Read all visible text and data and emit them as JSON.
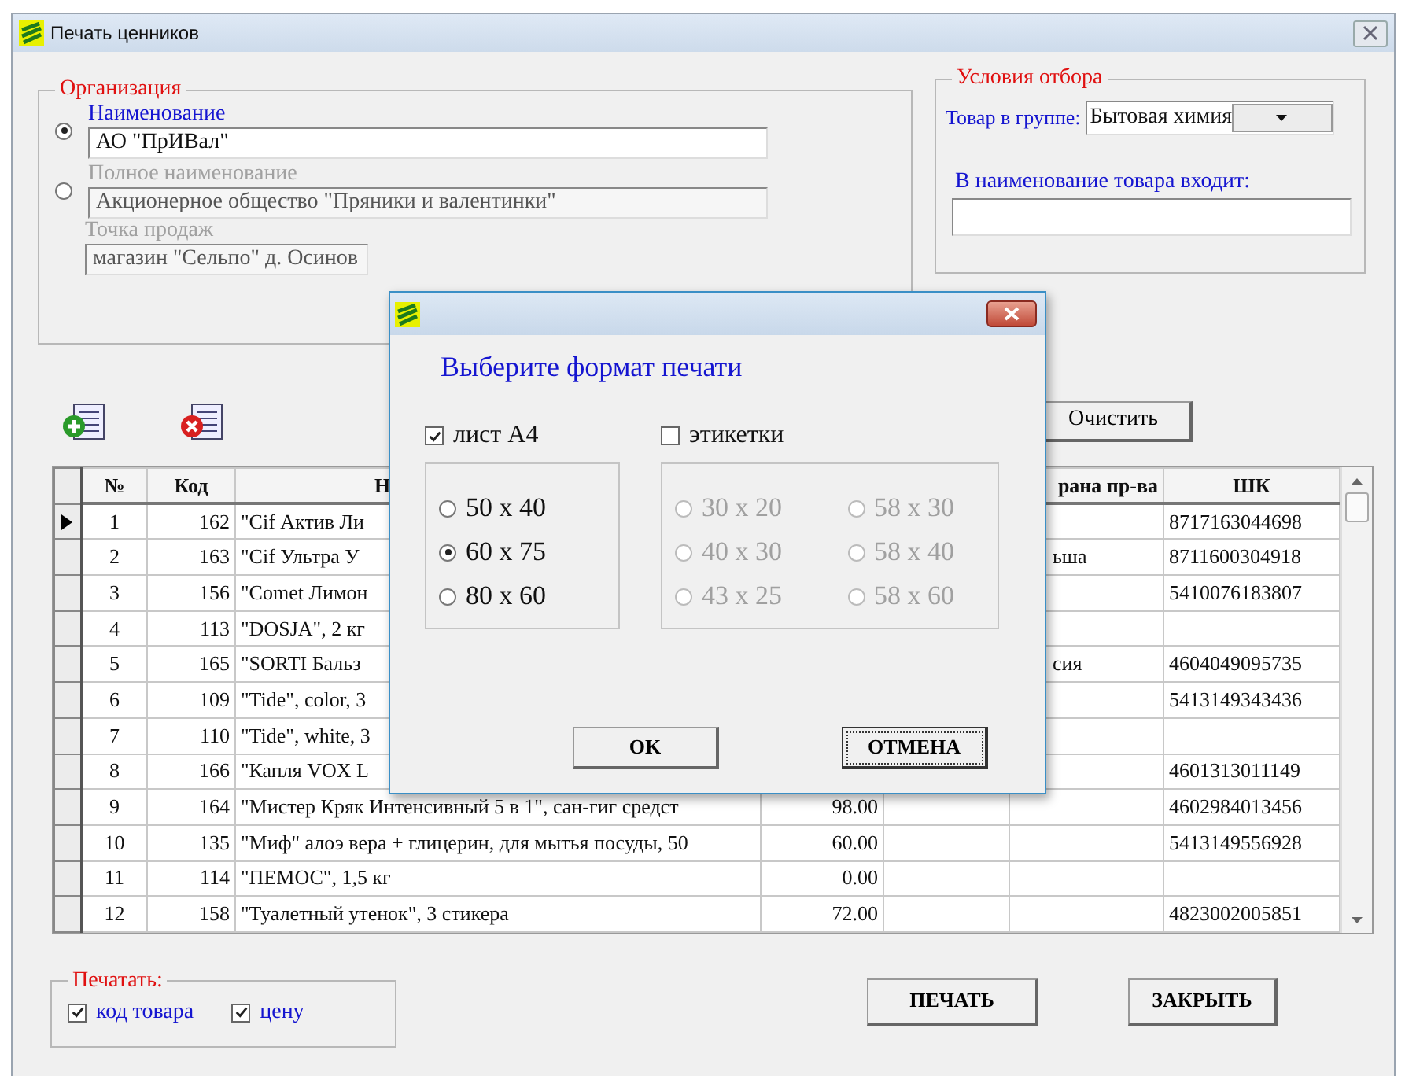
{
  "window": {
    "title": "Печать ценников"
  },
  "organization": {
    "title": "Организация",
    "options": [
      {
        "label": "Наименование",
        "value": "АО \"ПрИВал\"",
        "selected": true,
        "disabled": false
      },
      {
        "label": "Полное наименование",
        "value": "Акционерное общество \"Пряники и валентинки\"",
        "selected": false,
        "disabled": true
      }
    ],
    "sales_point": {
      "label": "Точка продаж",
      "value": "магазин \"Сельпо\" д. Осинов",
      "disabled": true
    }
  },
  "filter": {
    "title": "Условия отбора",
    "group_label": "Товар в группе:",
    "group_value": "Бытовая химия",
    "name_label": "В наименование товара входит:"
  },
  "clear_button": "Очистить",
  "table": {
    "columns": [
      {
        "label": "№"
      },
      {
        "label": "Код"
      },
      {
        "label": "Н"
      },
      {},
      {},
      {
        "label": "рана пр-ва"
      },
      {
        "label": "ШК"
      }
    ],
    "rows": [
      {
        "current": true,
        "cells": [
          "1",
          "162",
          "\"Cif Актив Ли",
          null,
          null,
          null,
          "8717163044698"
        ]
      },
      {
        "current": false,
        "cells": [
          "2",
          "163",
          "\"Cif Ультра У",
          null,
          null,
          "ьша",
          "8711600304918"
        ]
      },
      {
        "current": false,
        "cells": [
          "3",
          "156",
          "\"Comet Лимон",
          null,
          null,
          null,
          "5410076183807"
        ]
      },
      {
        "current": false,
        "cells": [
          "4",
          "113",
          "\"DOSJA\", 2 кг",
          null,
          null,
          null,
          null
        ]
      },
      {
        "current": false,
        "cells": [
          "5",
          "165",
          "\"SORTI Бальз",
          null,
          null,
          "сия",
          "4604049095735"
        ]
      },
      {
        "current": false,
        "cells": [
          "6",
          "109",
          "\"Tide\", color, 3",
          null,
          null,
          null,
          "5413149343436"
        ]
      },
      {
        "current": false,
        "cells": [
          "7",
          "110",
          "\"Tide\", white, 3",
          null,
          null,
          null,
          null
        ]
      },
      {
        "current": false,
        "cells": [
          "8",
          "166",
          "\"Капля VOX L",
          null,
          null,
          null,
          "4601313011149"
        ]
      },
      {
        "current": false,
        "cells": [
          "9",
          "164",
          "\"Мистер Кряк Интенсивный 5 в 1\", сан-гиг средст",
          "98.00",
          null,
          null,
          "4602984013456"
        ]
      },
      {
        "current": false,
        "cells": [
          "10",
          "135",
          "\"Миф\" алоэ вера + глицерин, для мытья посуды, 50",
          "60.00",
          null,
          null,
          "5413149556928"
        ]
      },
      {
        "current": false,
        "cells": [
          "11",
          "114",
          "\"ПЕМОС\", 1,5 кг",
          "0.00",
          null,
          null,
          null
        ]
      },
      {
        "current": false,
        "cells": [
          "12",
          "158",
          "\"Туалетный утенок\", 3 стикера",
          "72.00",
          null,
          null,
          "4823002005851"
        ]
      }
    ]
  },
  "print_options": {
    "title": "Печатать:",
    "items": [
      {
        "label": "код товара",
        "checked": true
      },
      {
        "label": "цену",
        "checked": true
      }
    ]
  },
  "buttons": [
    {
      "label": "ПЕЧАТЬ"
    },
    {
      "label": "ЗАКРЫТЬ"
    }
  ],
  "dialog": {
    "heading": "Выберите формат печати",
    "formats": [
      {
        "label": "лист А4",
        "checked": true,
        "sizes": [
          {
            "label": "50 x 40",
            "selected": false
          },
          {
            "label": "60 x 75",
            "selected": true
          },
          {
            "label": "80 x 60",
            "selected": false
          }
        ]
      },
      {
        "label": "этикетки",
        "checked": false,
        "sizes": [
          {
            "label": "30 x 20",
            "selected": false
          },
          {
            "label": "40 x 30",
            "selected": false
          },
          {
            "label": "43 x 25",
            "selected": false
          },
          {
            "label": "58 x 30",
            "selected": false
          },
          {
            "label": "58 x 40",
            "selected": false
          },
          {
            "label": "58 x 60",
            "selected": false
          }
        ]
      }
    ],
    "buttons": [
      {
        "label": "OK",
        "focused": false
      },
      {
        "label": "ОТМЕНА",
        "focused": true
      }
    ]
  }
}
